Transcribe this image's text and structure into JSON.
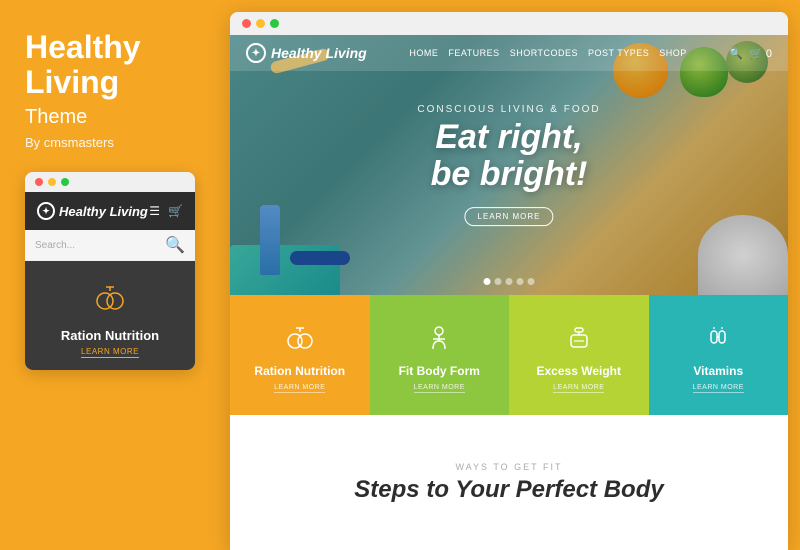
{
  "left": {
    "title_line1": "Healthy",
    "title_line2": "Living",
    "subtitle": "Theme",
    "author": "By cmsmasters",
    "mobile": {
      "logo": "Healthy Living",
      "search_placeholder": "Search...",
      "card_title": "Ration Nutrition",
      "card_learn": "LEARN MORE"
    }
  },
  "site": {
    "logo": "Healthy Living",
    "nav_links": [
      "HOME",
      "FEATURES",
      "SHORTCODES",
      "POST TYPES",
      "SHOP"
    ],
    "hero": {
      "subtext": "Conscious Living & Food",
      "title_line1": "Eat right,",
      "title_line2": "be bright!",
      "btn_label": "LEARN MORE"
    },
    "feature_cards": [
      {
        "title": "Ration Nutrition",
        "learn": "LEARN MORE",
        "color": "card-orange"
      },
      {
        "title": "Fit Body Form",
        "learn": "LEARN MORE",
        "color": "card-green"
      },
      {
        "title": "Excess Weight",
        "learn": "LEARN MORE",
        "color": "card-lime"
      },
      {
        "title": "Vitamins",
        "learn": "LEARN MORE",
        "color": "card-teal"
      }
    ],
    "bottom": {
      "ways_label": "WAYS TO GET FIT",
      "steps_title": "Steps to Your Perfect Body"
    }
  },
  "dots": {
    "red": "#ff5f57",
    "yellow": "#ffbd2e",
    "green": "#28c840"
  }
}
